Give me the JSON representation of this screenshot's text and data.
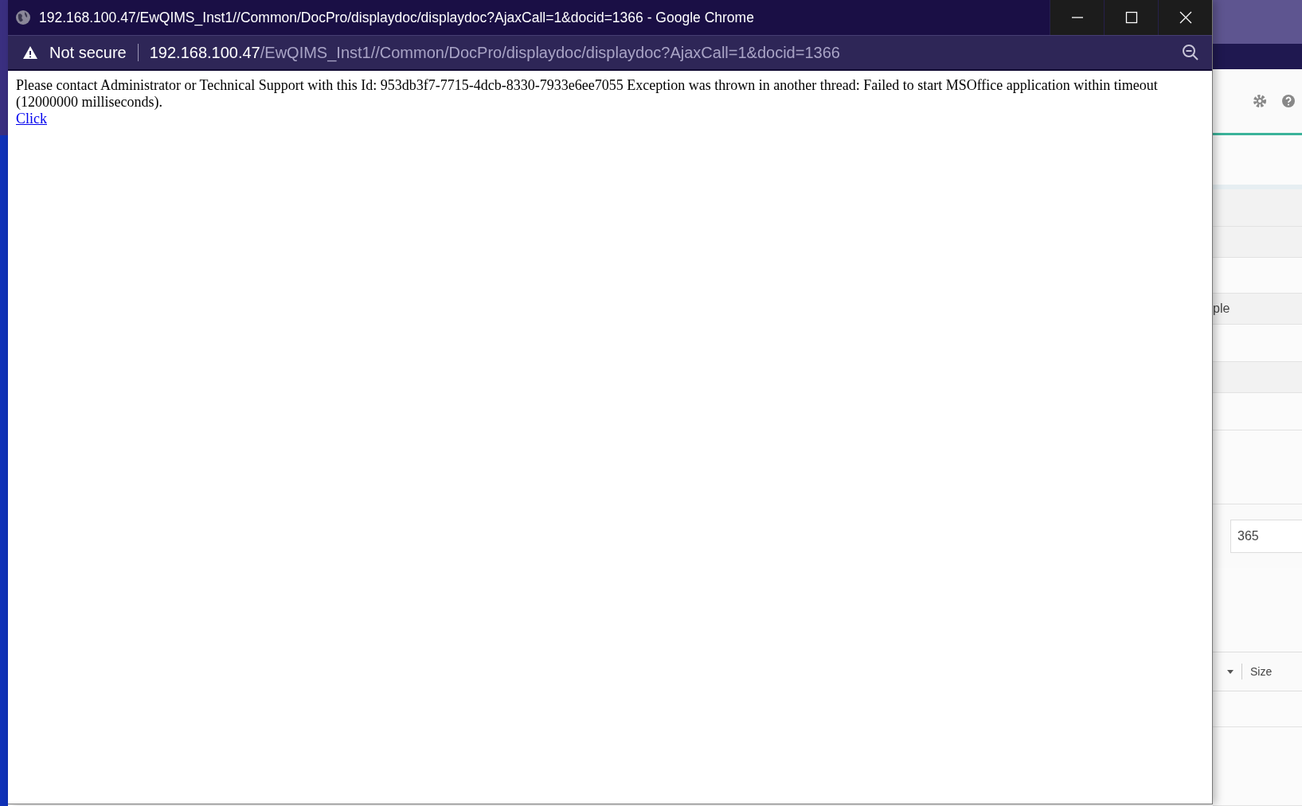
{
  "window": {
    "title": "192.168.100.47/EwQIMS_Inst1//Common/DocPro/displaydoc/displaydoc?AjaxCall=1&docid=1366 - Google Chrome",
    "address_bar": {
      "security": "Not secure",
      "host": "192.168.100.47",
      "path": "/EwQIMS_Inst1//Common/DocPro/displaydoc/displaydoc?AjaxCall=1&docid=1366"
    },
    "content": {
      "message": "Please contact Administrator or Technical Support with this Id: 953db3f7-7715-4dcb-8330-7933e6ee7055 Exception was thrown in another thread: Failed to start MSOffice application within timeout (12000000 milliseconds).",
      "link": "Click"
    }
  },
  "background_app": {
    "row_text": "ple",
    "field_value": "365",
    "column_header": "Size"
  }
}
